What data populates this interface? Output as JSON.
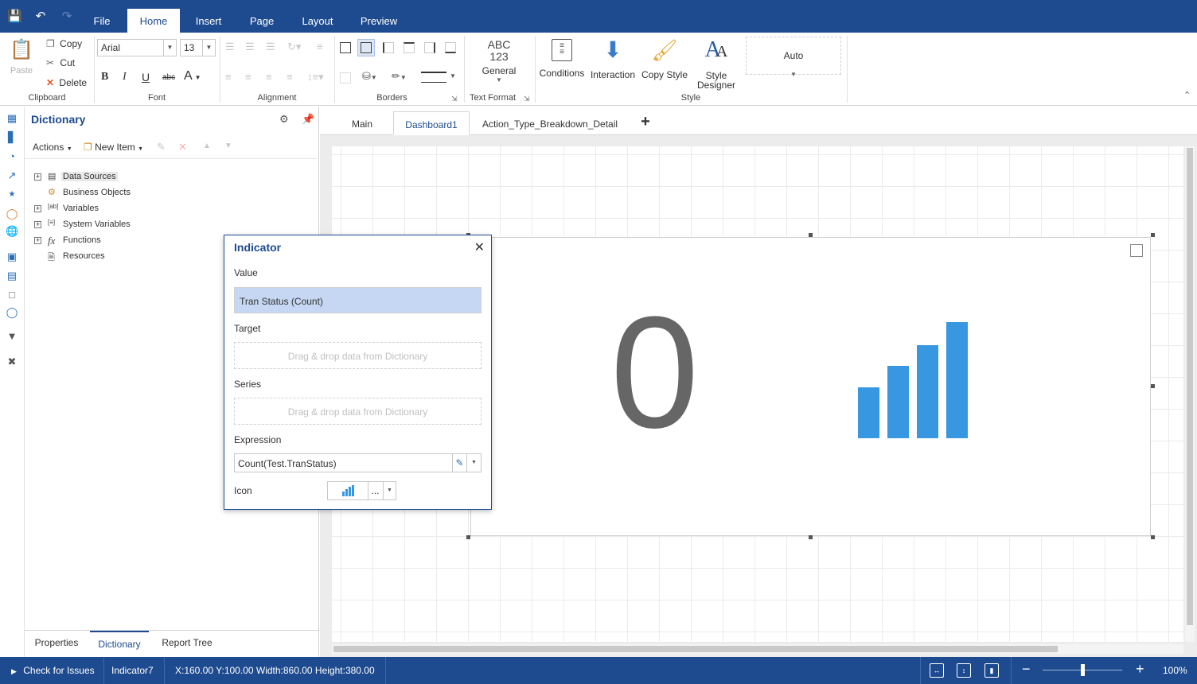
{
  "menubar": {
    "tabs": [
      "File",
      "Home",
      "Insert",
      "Page",
      "Layout",
      "Preview"
    ],
    "active_tab": "Home"
  },
  "ribbon": {
    "clipboard": {
      "paste": "Paste",
      "copy": "Copy",
      "cut": "Cut",
      "delete": "Delete",
      "label": "Clipboard"
    },
    "font": {
      "family": "Arial",
      "size": "13",
      "label": "Font"
    },
    "alignment": {
      "label": "Alignment"
    },
    "borders": {
      "label": "Borders"
    },
    "text_format": {
      "abc": "ABC",
      "num": "123",
      "general": "General",
      "label": "Text Format"
    },
    "style": {
      "conditions": "Conditions",
      "interaction": "Interaction",
      "copy_style": "Copy Style",
      "style_designer_1": "Style",
      "style_designer_2": "Designer",
      "auto": "Auto",
      "label": "Style"
    }
  },
  "dictionary": {
    "title": "Dictionary",
    "toolbar": {
      "actions": "Actions",
      "new_item": "New Item"
    },
    "tree": [
      {
        "label": "Data Sources",
        "expandable": true,
        "selected": true
      },
      {
        "label": "Business Objects",
        "expandable": false
      },
      {
        "label": "Variables",
        "expandable": true
      },
      {
        "label": "System Variables",
        "expandable": true
      },
      {
        "label": "Functions",
        "expandable": true
      },
      {
        "label": "Resources",
        "expandable": false
      }
    ],
    "bottom_tabs": [
      "Properties",
      "Dictionary",
      "Report Tree"
    ],
    "active_bottom_tab": "Dictionary"
  },
  "doc_tabs": [
    "Main",
    "Dashboard1",
    "Action_Type_Breakdown_Detail"
  ],
  "active_doc_tab": "Dashboard1",
  "indicator_widget": {
    "value": "0",
    "icon_bar_levels": [
      0.44,
      0.62,
      0.8,
      1.0
    ],
    "bar_color": "#3797e0"
  },
  "popup": {
    "title": "Indicator",
    "value_label": "Value",
    "value": "Tran Status (Count)",
    "target_label": "Target",
    "target_placeholder": "Drag & drop data from Dictionary",
    "series_label": "Series",
    "series_placeholder": "Drag & drop data from Dictionary",
    "expression_label": "Expression",
    "expression": "Count(Test.TranStatus)",
    "icon_label": "Icon",
    "icon_more": "..."
  },
  "statusbar": {
    "check_issues": "Check for Issues",
    "component": "Indicator7",
    "geometry": "X:160.00 Y:100.00 Width:860.00 Height:380.00",
    "zoom": "100%",
    "zoom_level": 0.5
  },
  "colors": {
    "accent": "#1e4b8f",
    "selection": "#c5d7f2"
  }
}
